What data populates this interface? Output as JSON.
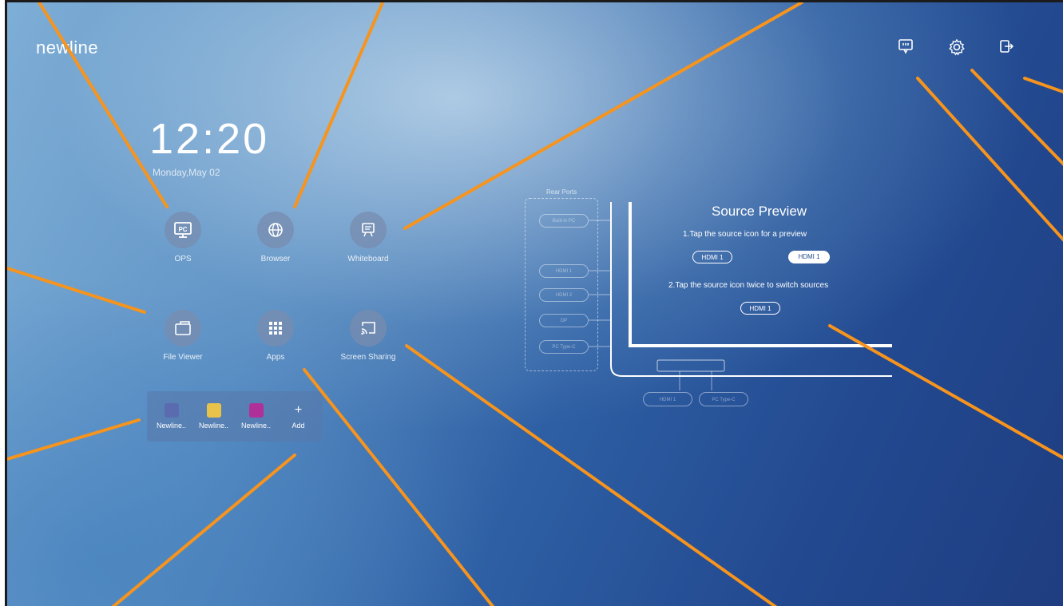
{
  "brand": {
    "logo": "newline"
  },
  "clock": {
    "time": "12:20",
    "date": "Monday,May 02"
  },
  "apps": [
    {
      "label": "OPS",
      "icon": "pc-icon"
    },
    {
      "label": "Browser",
      "icon": "globe-icon"
    },
    {
      "label": "Whiteboard",
      "icon": "whiteboard-icon"
    },
    {
      "label": "File Viewer",
      "icon": "folder-icon"
    },
    {
      "label": "Apps",
      "icon": "grid-icon"
    },
    {
      "label": "Screen Sharing",
      "icon": "cast-icon"
    }
  ],
  "dock": [
    {
      "label": "Newline..",
      "color": "#5b6bb0"
    },
    {
      "label": "Newline..",
      "color": "#e8c24a"
    },
    {
      "label": "Newline..",
      "color": "#b0309a"
    },
    {
      "label": "Add",
      "icon": "plus-icon"
    }
  ],
  "topbar": {
    "icons": [
      "input-source-icon",
      "gear-icon",
      "exit-icon"
    ]
  },
  "pc_badge": "PC",
  "source_preview": {
    "title": "Source Preview",
    "step1": "1.Tap the source icon for a preview",
    "step2": "2.Tap the source icon twice to switch sources",
    "hdmi_left": "HDMI 1",
    "hdmi_right": "HDMI 1",
    "hdmi_bottom": "HDMI 1",
    "rear_ports_label": "Rear Ports",
    "rear_ports": [
      "Built-in PC",
      "HDMI 1",
      "HDMI 2",
      "DP",
      "PC Type-C"
    ],
    "bottom_ports": [
      "HDMI 1",
      "PC Type-C"
    ]
  },
  "accent_color": "#f7941d"
}
